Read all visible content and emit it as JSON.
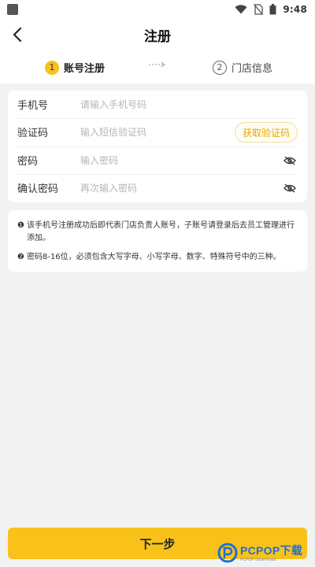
{
  "status_bar": {
    "time": "9:48",
    "icons": [
      "wifi-icon",
      "no-sim-icon",
      "battery-icon"
    ]
  },
  "header": {
    "title": "注册",
    "back_icon": "chevron-left-icon"
  },
  "steps": [
    {
      "number": "1",
      "label": "账号注册",
      "active": true
    },
    {
      "number": "2",
      "label": "门店信息",
      "active": false
    }
  ],
  "form": {
    "phone": {
      "label": "手机号",
      "placeholder": "请输入手机号码",
      "value": ""
    },
    "code": {
      "label": "验证码",
      "placeholder": "输入短信验证码",
      "value": "",
      "button": "获取验证码"
    },
    "password": {
      "label": "密码",
      "placeholder": "输入密码",
      "value": ""
    },
    "confirm": {
      "label": "确认密码",
      "placeholder": "再次输入密码",
      "value": ""
    }
  },
  "notes": [
    {
      "bullet": "❶",
      "text": "该手机号注册成功后即代表门店负责人账号，子账号请登录后去员工管理进行添加。"
    },
    {
      "bullet": "❷",
      "text": "密码8-16位，必须包含大写字母、小写字母、数字、特殊符号中的三种。"
    }
  ],
  "footer": {
    "next_label": "下一步"
  },
  "watermark": {
    "brand": "PCPOP",
    "suffix": "下载",
    "sub": "PCPOP Download"
  },
  "colors": {
    "accent": "#f9c21a",
    "code_button_text": "#e4a900",
    "background": "#f2f2f2"
  }
}
